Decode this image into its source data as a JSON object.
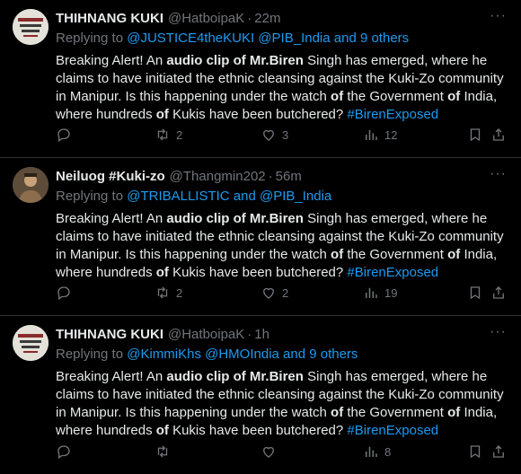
{
  "tweets": [
    {
      "display_name": "THIHNANG KUKI",
      "handle": "@HatboipaK",
      "time": "22m",
      "replying_prefix": "Replying to",
      "replying_links": "@JUSTICE4theKUKI @PIB_India and 9 others",
      "body": {
        "t1": "Breaking Alert! An ",
        "b1": "audio clip",
        "t2": " ",
        "b2": "of Mr.Biren",
        "t3": " Singh has emerged, where he claims to have initiated the ethnic cleansing against the Kuki-Zo community in Manipur. Is this happening under the watch ",
        "b3": "of",
        "t4": " the Government ",
        "b4": "of",
        "t5": " India, where hundreds ",
        "b5": "of",
        "t6": " Kukis have been butchered? ",
        "hashtag": "#BirenExposed"
      },
      "stats": {
        "retweets": "2",
        "likes": "3",
        "views": "12"
      }
    },
    {
      "display_name": "Neiluog #Kuki-zo",
      "handle": "@Thangmin202",
      "time": "56m",
      "replying_prefix": "Replying to",
      "replying_links": "@TRIBALLISTIC and @PIB_India",
      "body": {
        "t1": "Breaking Alert! An ",
        "b1": "audio clip",
        "t2": " ",
        "b2": "of Mr.Biren",
        "t3": " Singh has emerged, where he claims to have initiated the ethnic cleansing against the Kuki-Zo community in Manipur. Is this happening under the watch ",
        "b3": "of",
        "t4": " the Government ",
        "b4": "of",
        "t5": " India, where hundreds ",
        "b5": "of",
        "t6": " Kukis have been butchered? ",
        "hashtag": "#BirenExposed"
      },
      "stats": {
        "retweets": "2",
        "likes": "2",
        "views": "19"
      }
    },
    {
      "display_name": "THIHNANG KUKI",
      "handle": "@HatboipaK",
      "time": "1h",
      "replying_prefix": "Replying to",
      "replying_links": "@KimmiKhs @HMOIndia and 9 others",
      "body": {
        "t1": "Breaking Alert! An ",
        "b1": "audio clip",
        "t2": " ",
        "b2": "of Mr.Biren",
        "t3": " Singh has emerged, where he claims to have initiated the ethnic cleansing against the Kuki-Zo community in Manipur. Is this happening under the watch ",
        "b3": "of",
        "t4": " the Government ",
        "b4": "of",
        "t5": " India, where hundreds ",
        "b5": "of",
        "t6": " Kukis have been butchered? ",
        "hashtag": "#BirenExposed"
      },
      "stats": {
        "retweets": "",
        "likes": "",
        "views": "8"
      }
    }
  ],
  "ui": {
    "dot": "·",
    "more": "···",
    "icons": [
      "reply-icon",
      "retweet-icon",
      "like-icon",
      "views-icon",
      "bookmark-icon",
      "share-icon",
      "more-icon"
    ],
    "colors": {
      "background": "#000000",
      "text": "#e7e9ea",
      "muted": "#71767b",
      "link": "#1d9bf0",
      "border": "#2f3336"
    }
  }
}
